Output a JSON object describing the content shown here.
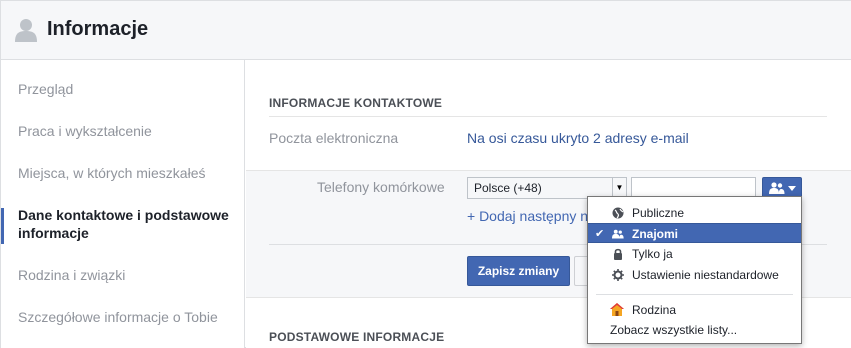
{
  "header": {
    "title": "Informacje"
  },
  "nav": {
    "items": [
      {
        "label": "Przegląd"
      },
      {
        "label": "Praca i wykształcenie"
      },
      {
        "label": "Miejsca, w których mieszkałeś"
      },
      {
        "label": "Dane kontaktowe i podstawowe informacje",
        "active": true
      },
      {
        "label": "Rodzina i związki"
      },
      {
        "label": "Szczegółowe informacje o Tobie"
      }
    ]
  },
  "contact": {
    "section_title": "INFORMACJE KONTAKTOWE",
    "email_label": "Poczta elektroniczna",
    "email_value": "Na osi czasu ukryto 2 adresy e-mail",
    "phones_label": "Telefony komórkowe",
    "country_select": "Polsce (+48)",
    "phone_value": "",
    "add_link": "+ Dodaj następny n",
    "save_label": "Zapisz zmiany"
  },
  "basic": {
    "section_title": "PODSTAWOWE INFORMACJE"
  },
  "privacy_menu": {
    "items": [
      {
        "label": "Publiczne",
        "icon": "globe-icon"
      },
      {
        "label": "Znajomi",
        "icon": "friends-icon",
        "selected": true
      },
      {
        "label": "Tylko ja",
        "icon": "lock-icon"
      },
      {
        "label": "Ustawienie niestandardowe",
        "icon": "gear-icon"
      }
    ],
    "list_item": {
      "label": "Rodzina",
      "icon": "house-icon"
    },
    "see_all": "Zobacz wszystkie listy..."
  },
  "colors": {
    "accent": "#4267b2",
    "link": "#365899",
    "muted": "#90949c"
  }
}
